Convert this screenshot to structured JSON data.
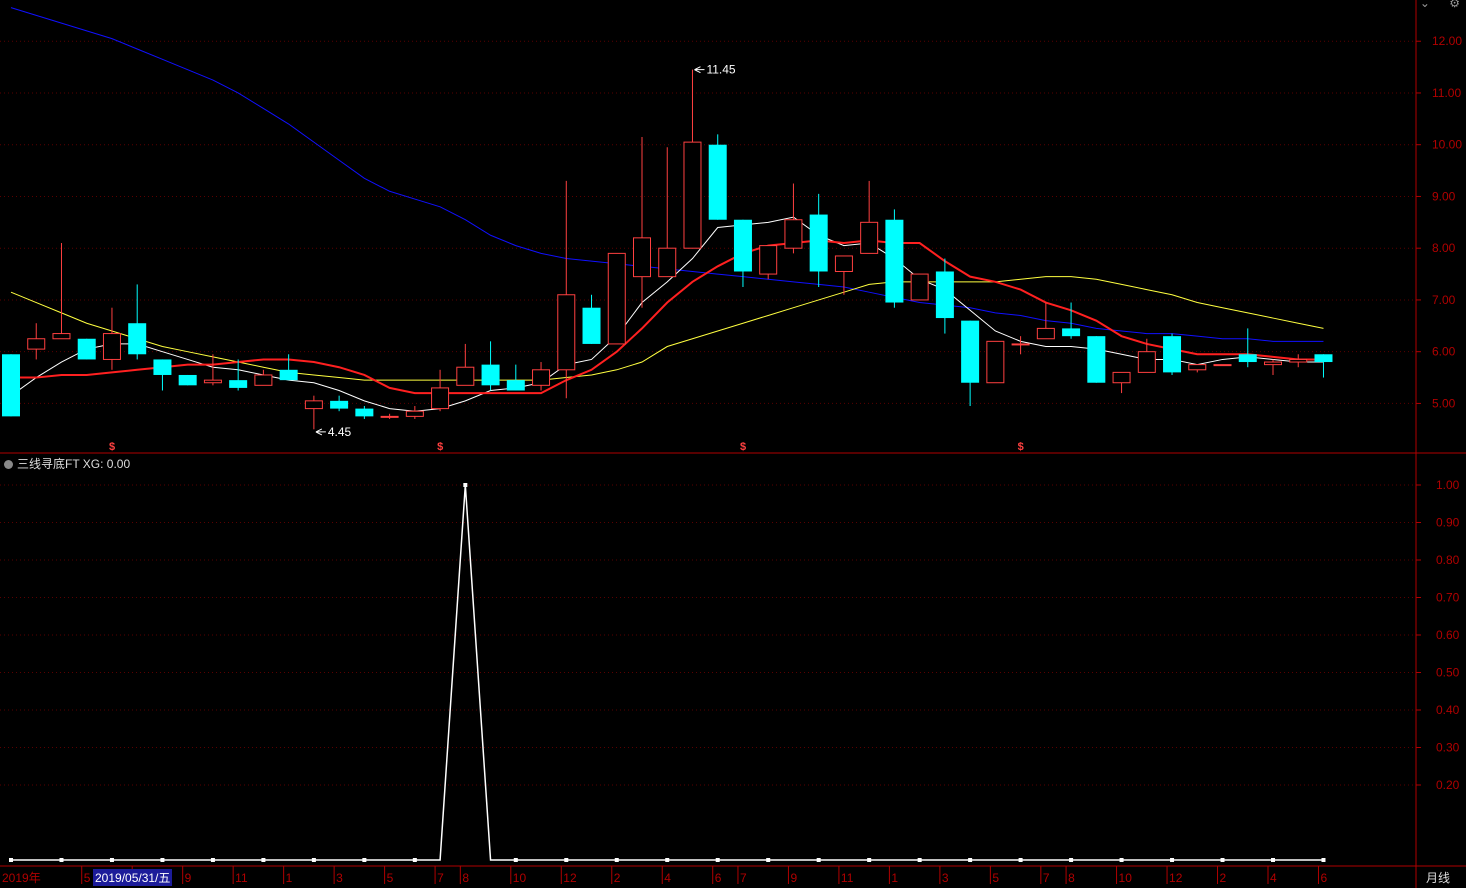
{
  "window": {
    "buttons": [
      "chevron-down-icon",
      "settings-icon"
    ]
  },
  "indicator": {
    "name": "三线寻底FT",
    "value_label": "XG: 0.00"
  },
  "period_label": "月线",
  "selected_date": "2019/05/31/五",
  "colors": {
    "up": "#ff4040",
    "down": "#00ffff",
    "ma5": "#ffffff",
    "ma10": "#ff2020",
    "ma20": "#ffff40",
    "ma60": "#1010ff",
    "axis": "#b00000",
    "grid": "#5a0000"
  },
  "chart_data": [
    {
      "type": "candlestick",
      "ylim": [
        4.1,
        12.7
      ],
      "y_ticks": [
        "5.00",
        "6.00",
        "7.00",
        "8.00",
        "9.00",
        "10.00",
        "11.00",
        "12.00"
      ],
      "candles": [
        [
          5.95,
          4.75,
          5.95,
          4.75
        ],
        [
          6.05,
          6.25,
          6.55,
          5.85
        ],
        [
          6.25,
          6.35,
          8.1,
          6.25
        ],
        [
          6.25,
          5.85,
          6.25,
          5.85
        ],
        [
          5.85,
          6.35,
          6.85,
          5.65
        ],
        [
          6.55,
          5.95,
          7.3,
          5.85
        ],
        [
          5.85,
          5.55,
          5.85,
          5.25
        ],
        [
          5.55,
          5.35,
          5.55,
          5.35
        ],
        [
          5.4,
          5.45,
          5.95,
          5.35
        ],
        [
          5.45,
          5.3,
          5.85,
          5.25
        ],
        [
          5.35,
          5.55,
          5.65,
          5.35
        ],
        [
          5.65,
          5.45,
          5.95,
          5.45
        ],
        [
          4.9,
          5.05,
          5.15,
          4.5
        ],
        [
          5.05,
          4.9,
          5.15,
          4.85
        ],
        [
          4.9,
          4.75,
          4.95,
          4.7
        ],
        [
          4.75,
          4.75,
          4.8,
          4.7
        ],
        [
          4.75,
          4.85,
          4.95,
          4.7
        ],
        [
          4.9,
          5.3,
          5.65,
          4.85
        ],
        [
          5.35,
          5.7,
          6.15,
          5.35
        ],
        [
          5.75,
          5.35,
          6.2,
          5.25
        ],
        [
          5.45,
          5.25,
          5.75,
          5.25
        ],
        [
          5.35,
          5.65,
          5.8,
          5.25
        ],
        [
          5.65,
          7.1,
          9.3,
          5.1
        ],
        [
          6.85,
          6.15,
          7.1,
          6.15
        ],
        [
          6.15,
          7.9,
          7.9,
          6.15
        ],
        [
          7.45,
          8.2,
          10.15,
          6.85
        ],
        [
          7.45,
          8.0,
          9.95,
          7.45
        ],
        [
          8.0,
          10.05,
          11.45,
          8.0
        ],
        [
          10.0,
          8.55,
          10.2,
          8.55
        ],
        [
          8.55,
          7.55,
          8.55,
          7.25
        ],
        [
          7.5,
          8.05,
          8.05,
          7.4
        ],
        [
          8.0,
          8.55,
          9.25,
          7.9
        ],
        [
          8.65,
          7.55,
          9.05,
          7.25
        ],
        [
          7.55,
          7.85,
          7.85,
          7.1
        ],
        [
          7.9,
          8.5,
          9.3,
          7.9
        ],
        [
          8.55,
          6.95,
          8.75,
          6.85
        ],
        [
          7.0,
          7.5,
          7.5,
          7.0
        ],
        [
          7.55,
          6.65,
          7.8,
          6.35
        ],
        [
          6.6,
          5.4,
          6.6,
          4.95
        ],
        [
          5.4,
          6.2,
          6.2,
          5.4
        ],
        [
          6.15,
          6.15,
          6.3,
          5.95
        ],
        [
          6.25,
          6.45,
          6.95,
          6.25
        ],
        [
          6.45,
          6.3,
          6.95,
          6.25
        ],
        [
          6.3,
          5.4,
          6.3,
          5.4
        ],
        [
          5.4,
          5.6,
          5.6,
          5.2
        ],
        [
          5.6,
          6.0,
          6.25,
          5.6
        ],
        [
          6.3,
          5.6,
          6.35,
          5.55
        ],
        [
          5.65,
          5.75,
          5.75,
          5.6
        ],
        [
          5.75,
          5.75,
          5.75,
          5.75
        ],
        [
          5.95,
          5.8,
          6.45,
          5.7
        ],
        [
          5.75,
          5.8,
          5.85,
          5.55
        ],
        [
          5.8,
          5.85,
          5.95,
          5.7
        ],
        [
          5.95,
          5.8,
          5.95,
          5.5
        ]
      ],
      "ma_lines": {
        "ma5": [
          5.15,
          5.5,
          5.8,
          6.05,
          6.15,
          6.15,
          6.0,
          5.85,
          5.7,
          5.65,
          5.55,
          5.45,
          5.4,
          5.25,
          5.05,
          4.9,
          4.85,
          4.9,
          5.05,
          5.25,
          5.3,
          5.4,
          5.75,
          5.85,
          6.3,
          6.95,
          7.35,
          7.8,
          8.4,
          8.45,
          8.5,
          8.6,
          8.25,
          8.05,
          8.1,
          7.8,
          7.4,
          7.2,
          6.8,
          6.4,
          6.2,
          6.1,
          6.1,
          6.05,
          5.95,
          5.85,
          5.85,
          5.75,
          5.85,
          5.9,
          5.85,
          5.8,
          5.8
        ],
        "ma10": [
          5.5,
          5.5,
          5.55,
          5.55,
          5.6,
          5.65,
          5.7,
          5.75,
          5.75,
          5.8,
          5.85,
          5.85,
          5.8,
          5.7,
          5.55,
          5.3,
          5.2,
          5.2,
          5.2,
          5.2,
          5.2,
          5.2,
          5.45,
          5.65,
          6.0,
          6.45,
          6.95,
          7.35,
          7.65,
          7.9,
          8.05,
          8.1,
          8.15,
          8.1,
          8.15,
          8.1,
          8.1,
          7.75,
          7.45,
          7.35,
          7.2,
          6.95,
          6.8,
          6.6,
          6.3,
          6.15,
          6.05,
          5.95,
          5.95,
          5.95,
          5.9,
          5.85,
          5.85
        ],
        "ma20": [
          7.15,
          6.95,
          6.75,
          6.55,
          6.4,
          6.25,
          6.1,
          6.0,
          5.9,
          5.8,
          5.7,
          5.6,
          5.55,
          5.5,
          5.45,
          5.45,
          5.45,
          5.45,
          5.45,
          5.45,
          5.45,
          5.45,
          5.5,
          5.55,
          5.65,
          5.8,
          6.1,
          6.25,
          6.4,
          6.55,
          6.7,
          6.85,
          7.0,
          7.15,
          7.3,
          7.35,
          7.35,
          7.35,
          7.35,
          7.35,
          7.4,
          7.45,
          7.45,
          7.4,
          7.3,
          7.2,
          7.1,
          6.95,
          6.85,
          6.75,
          6.65,
          6.55,
          6.45
        ],
        "ma60": [
          12.65,
          12.5,
          12.35,
          12.2,
          12.05,
          11.85,
          11.65,
          11.45,
          11.25,
          11.0,
          10.7,
          10.4,
          10.05,
          9.7,
          9.35,
          9.1,
          8.95,
          8.8,
          8.55,
          8.25,
          8.05,
          7.9,
          7.8,
          7.75,
          7.7,
          7.65,
          7.6,
          7.55,
          7.5,
          7.45,
          7.4,
          7.35,
          7.3,
          7.25,
          7.15,
          7.05,
          6.95,
          6.9,
          6.85,
          6.75,
          6.7,
          6.6,
          6.55,
          6.45,
          6.4,
          6.35,
          6.35,
          6.3,
          6.25,
          6.25,
          6.2,
          6.2,
          6.2
        ]
      },
      "annotations": [
        {
          "text": "11.45",
          "bar": 27,
          "y": 11.45
        },
        {
          "text": "4.45",
          "bar": 12,
          "y": 4.45
        }
      ],
      "markers": [
        {
          "text": "$",
          "bar": 4
        },
        {
          "text": "$",
          "bar": 17
        },
        {
          "text": "$",
          "bar": 29
        },
        {
          "text": "$",
          "bar": 40
        }
      ]
    },
    {
      "type": "line",
      "title": "三线寻底FT",
      "ylim": [
        0,
        1.04
      ],
      "y_ticks": [
        "1.00",
        "0.90",
        "0.80",
        "0.70",
        "0.60",
        "0.50",
        "0.40",
        "0.30",
        "0.20"
      ],
      "values": [
        0,
        0,
        0,
        0,
        0,
        0,
        0,
        0,
        0,
        0,
        0,
        0,
        0,
        0,
        0,
        0,
        0,
        0,
        1,
        0,
        0,
        0,
        0,
        0,
        0,
        0,
        0,
        0,
        0,
        0,
        0,
        0,
        0,
        0,
        0,
        0,
        0,
        0,
        0,
        0,
        0,
        0,
        0,
        0,
        0,
        0,
        0,
        0,
        0,
        0,
        0,
        0,
        0
      ]
    }
  ],
  "x_axis": {
    "year_label": "2019年",
    "tick_labels": [
      "5",
      "7",
      "9",
      "11",
      "1",
      "3",
      "5",
      "7",
      "8",
      "10",
      "12",
      "2",
      "4",
      "6",
      "7",
      "9",
      "11",
      "1",
      "3",
      "5",
      "7",
      "8",
      "10",
      "12",
      "2",
      "4",
      "6"
    ],
    "tick_bars": [
      3,
      5,
      7,
      9,
      11,
      13,
      15,
      17,
      18,
      20,
      22,
      24,
      26,
      28,
      29,
      31,
      33,
      35,
      37,
      39,
      41,
      42,
      44,
      46,
      48,
      50,
      52
    ]
  }
}
